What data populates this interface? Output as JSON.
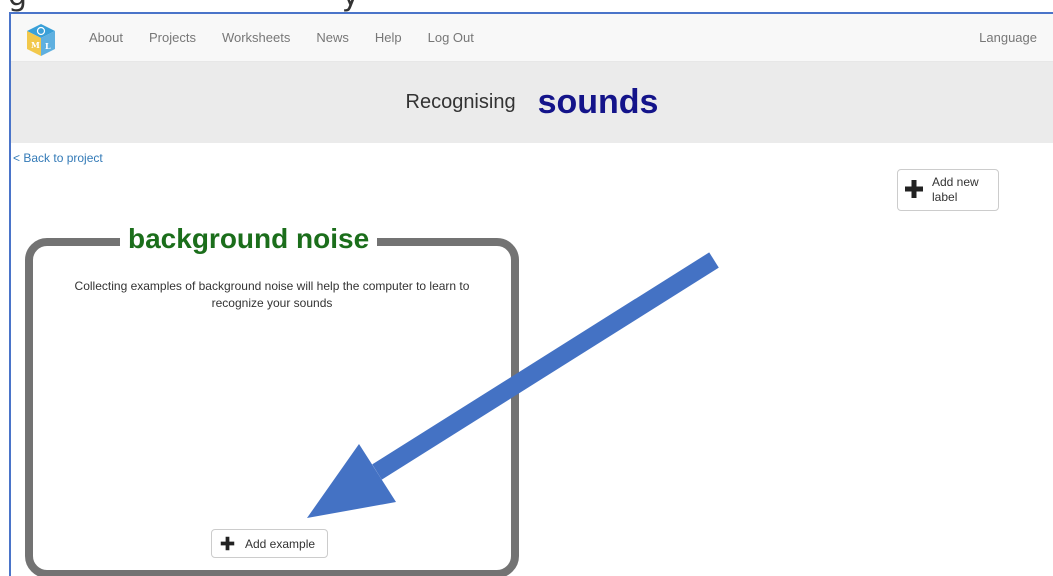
{
  "nav": {
    "items": [
      "About",
      "Projects",
      "Worksheets",
      "News",
      "Help",
      "Log Out"
    ],
    "language_label": "Language"
  },
  "banner": {
    "label": "Recognising",
    "project_title": "sounds"
  },
  "back_link": "< Back to project",
  "add_label_button": "Add new label",
  "label_card": {
    "name": "background noise",
    "description": "Collecting examples of background noise will help the computer to learn to recognize your sounds",
    "add_example_button": "Add example"
  },
  "colors": {
    "banner_title": "#14148a",
    "label_name": "#1b6e1b",
    "link": "#337ab7",
    "annotation_arrow": "#4472c4"
  }
}
